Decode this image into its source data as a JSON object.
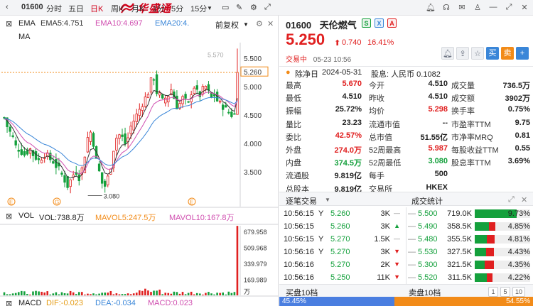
{
  "app": {
    "brand": "华盛通"
  },
  "topbar": {
    "code": "01600",
    "periods": [
      "分时",
      "五日",
      "日K",
      "周K",
      "月K",
      "1分",
      "5分",
      "15分"
    ],
    "active_period": "日K"
  },
  "chart": {
    "ema_label": "EMA",
    "ema5": "EMA5:4.751",
    "ema10": "EMA10:4.697",
    "ema20": "EMA20:4.",
    "adjust": "前复权",
    "ma_label": "MA",
    "price_ticks": [
      "5.570",
      "5.500",
      "5.260",
      "5.000",
      "4.500",
      "4.000",
      "3.500"
    ],
    "low_marker": "3.080",
    "event_markers": [
      "E",
      "G",
      "E"
    ],
    "vol_label": "VOL",
    "vol": "VOL:738.8万",
    "mavol5": "MAVOL5:247.5万",
    "mavol10": "MAVOL10:167.8万",
    "vol_ticks": [
      "679.958",
      "509.968",
      "339.979",
      "169.989",
      "万"
    ],
    "macd_label": "MACD",
    "dif": "DIF:-0.023",
    "dea": "DEA:-0.034",
    "macd": "MACD:0.023",
    "colors": {
      "up": "#e02020",
      "down": "#14a03c",
      "ema5": "#333333",
      "ema10": "#d04fb0",
      "ema20": "#3a86d8"
    }
  },
  "stock": {
    "code": "01600",
    "name": "天伦燃气",
    "badges": [
      "S",
      "X",
      "A"
    ],
    "price": "5.250",
    "change": "0.740",
    "change_pct": "16.41%",
    "status": "交易中",
    "time": "05-23 10:56",
    "actions": [
      "买",
      "卖",
      "+"
    ]
  },
  "dividend": {
    "label": "除净日",
    "date": "2024-05-31",
    "desc": "股息: 人民币 0.1082"
  },
  "stats": [
    [
      {
        "l": "最高",
        "v": "5.670",
        "c": "red"
      },
      {
        "l": "今开",
        "v": "4.510",
        "c": "black"
      },
      {
        "l": "成交量",
        "v": "736.5万",
        "c": "black"
      }
    ],
    [
      {
        "l": "最低",
        "v": "4.510",
        "c": "black"
      },
      {
        "l": "昨收",
        "v": "4.510",
        "c": "black"
      },
      {
        "l": "成交额",
        "v": "3902万",
        "c": "black"
      }
    ],
    [
      {
        "l": "振幅",
        "v": "25.72%",
        "c": "black"
      },
      {
        "l": "均价",
        "v": "5.298",
        "c": "red"
      },
      {
        "l": "换手率",
        "v": "0.75%",
        "c": "black"
      }
    ],
    [
      {
        "l": "量比",
        "v": "23.23",
        "c": "black"
      },
      {
        "l": "流通市值",
        "v": "--",
        "c": "black"
      },
      {
        "l": "市盈率TTM",
        "v": "9.75",
        "c": "black"
      }
    ],
    [
      {
        "l": "委比",
        "v": "42.57%",
        "c": "red"
      },
      {
        "l": "总市值",
        "v": "51.55亿",
        "c": "black"
      },
      {
        "l": "市净率MRQ",
        "v": "0.81",
        "c": "black"
      }
    ],
    [
      {
        "l": "外盘",
        "v": "274.0万",
        "c": "red"
      },
      {
        "l": "52周最高",
        "v": "5.987",
        "c": "red"
      },
      {
        "l": "每股收益TTM",
        "v": "0.55",
        "c": "black"
      }
    ],
    [
      {
        "l": "内盘",
        "v": "374.5万",
        "c": "green"
      },
      {
        "l": "52周最低",
        "v": "3.080",
        "c": "green"
      },
      {
        "l": "股息率TTM",
        "v": "3.69%",
        "c": "black"
      }
    ],
    [
      {
        "l": "流通股",
        "v": "9.819亿",
        "c": "black"
      },
      {
        "l": "每手",
        "v": "500",
        "c": "black"
      },
      {
        "l": "",
        "v": "",
        "c": "black"
      }
    ],
    [
      {
        "l": "总股本",
        "v": "9.819亿",
        "c": "black"
      },
      {
        "l": "交易所",
        "v": "HKEX",
        "c": "black"
      },
      {
        "l": "",
        "v": "",
        "c": "black"
      }
    ]
  ],
  "sections": {
    "trades_title": "逐笔交易",
    "stats_title": "成交统计",
    "buy_tab": "买盘10档",
    "sell_tab": "卖盘10档"
  },
  "trades": [
    {
      "time": "10:56:15",
      "side": "Y",
      "price": "5.260",
      "qty": "3K",
      "dir": "neutral"
    },
    {
      "time": "10:56:15",
      "side": "",
      "price": "5.260",
      "qty": "3K",
      "dir": "up"
    },
    {
      "time": "10:56:15",
      "side": "Y",
      "price": "5.270",
      "qty": "1.5K",
      "dir": "neutral"
    },
    {
      "time": "10:56:16",
      "side": "Y",
      "price": "5.270",
      "qty": "3K",
      "dir": "down"
    },
    {
      "time": "10:56:16",
      "side": "",
      "price": "5.270",
      "qty": "2K",
      "dir": "down"
    },
    {
      "time": "10:56:16",
      "side": "",
      "price": "5.250",
      "qty": "11K",
      "dir": "down"
    }
  ],
  "trade_stats": [
    {
      "price": "5.500",
      "vol": "719.0K",
      "pct": "9.73%",
      "buy": 0.75,
      "sell": 0.0
    },
    {
      "price": "5.490",
      "vol": "358.5K",
      "pct": "4.85%",
      "buy": 0.25,
      "sell": 0.12
    },
    {
      "price": "5.480",
      "vol": "355.5K",
      "pct": "4.81%",
      "buy": 0.22,
      "sell": 0.14
    },
    {
      "price": "5.530",
      "vol": "327.5K",
      "pct": "4.43%",
      "buy": 0.2,
      "sell": 0.14
    },
    {
      "price": "5.300",
      "vol": "321.5K",
      "pct": "4.35%",
      "buy": 0.18,
      "sell": 0.16
    },
    {
      "price": "5.520",
      "vol": "311.5K",
      "pct": "4.22%",
      "buy": 0.22,
      "sell": 0.1
    }
  ],
  "pages": [
    "1",
    "5",
    "10"
  ],
  "ratio": {
    "buy_pct": "45.45%",
    "sell_pct": "54.55%",
    "buy": 0.4545
  }
}
